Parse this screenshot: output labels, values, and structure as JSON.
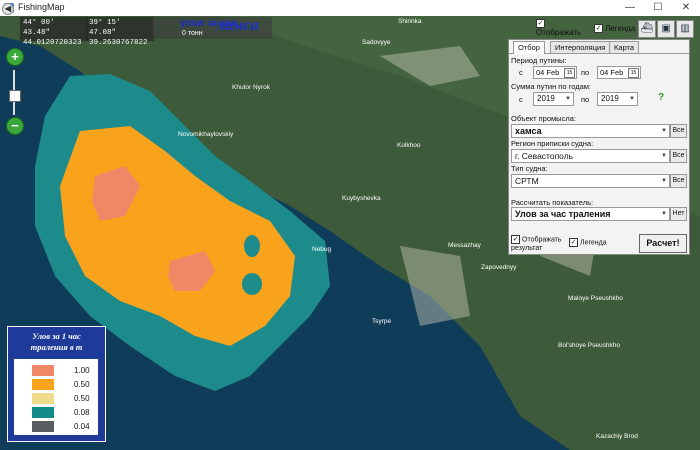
{
  "app": {
    "title": "FishingMap",
    "minimize": "—",
    "maximize": "☐",
    "close": "✕"
  },
  "coords": {
    "box1": {
      "lat": "44° 00' 43.48\"",
      "lon": "44.0120720323"
    },
    "box2": {
      "lat": "39° 15' 47.08\"",
      "lon": "39.2630767822"
    }
  },
  "metric": {
    "title": "улов за час",
    "value": "0 тонн"
  },
  "species_title": "хамса",
  "top_checks": {
    "show_result": {
      "label": "Отображать результат",
      "checked": true
    },
    "legend": {
      "label": "Легенда",
      "checked": true
    }
  },
  "toolbar_icons": [
    "ship-icon",
    "camera-icon",
    "book-icon"
  ],
  "map_labels": [
    {
      "text": "Shirinka"
    },
    {
      "text": "Sadovyye"
    },
    {
      "text": "Khutor Nyrok"
    },
    {
      "text": "Novomikhaylovskiy"
    },
    {
      "text": "Kolkhoo"
    },
    {
      "text": "Kuybyshevka"
    },
    {
      "text": "Nebug"
    },
    {
      "text": "Messazhay"
    },
    {
      "text": "Zapovednyy"
    },
    {
      "text": "Maloye Pseushkho"
    },
    {
      "text": "Bol'shoye Pseushkho"
    },
    {
      "text": "Tsyrpe"
    },
    {
      "text": "Kazachiy Brod"
    }
  ],
  "panel": {
    "tabs": [
      "Отбор",
      "Интерполяция",
      "Карта"
    ],
    "active_tab": 0,
    "period_label": "Период путины:",
    "from_label": "с",
    "to_label": "по",
    "date_from": "04 Feb",
    "date_to": "04 Feb",
    "cal_icon": "15",
    "sum_label": "Сумма путин по годам:",
    "year_from": "2019",
    "year_to": "2019",
    "help": "?",
    "object_label": "Объект промысла:",
    "object_value": "хамса",
    "region_label": "Регион приписки судна:",
    "region_value": "г. Севастополь",
    "vessel_label": "Тип судна:",
    "vessel_value": "СРТМ",
    "indicator_label": "Рассчитать показатель:",
    "indicator_value": "Улов за час траления",
    "all_btn": "Все",
    "none_btn": "Нет",
    "show_result": "Отображать результат",
    "legend": "Легенда",
    "calc": "Расчет!"
  },
  "legend": {
    "title_line1": "Улов за 1 час",
    "title_line2": "траления в т",
    "items": [
      {
        "color": "#f08766",
        "value": "1.00"
      },
      {
        "color": "#f9a21c",
        "value": "0.50"
      },
      {
        "color": "#f1dc8b",
        "value": "0.50"
      },
      {
        "color": "#138a8a",
        "value": "0.08"
      },
      {
        "color": "#5a5e63",
        "value": "0.04"
      }
    ]
  },
  "colors": {
    "sea": "#0f3c58",
    "land": "#3d5a3a",
    "teal": "#1d8b8c",
    "orange": "#f9a21c",
    "salmon": "#f08766"
  },
  "nav": {
    "zoom_in": "+",
    "zoom_out": "−",
    "back": "◀"
  }
}
